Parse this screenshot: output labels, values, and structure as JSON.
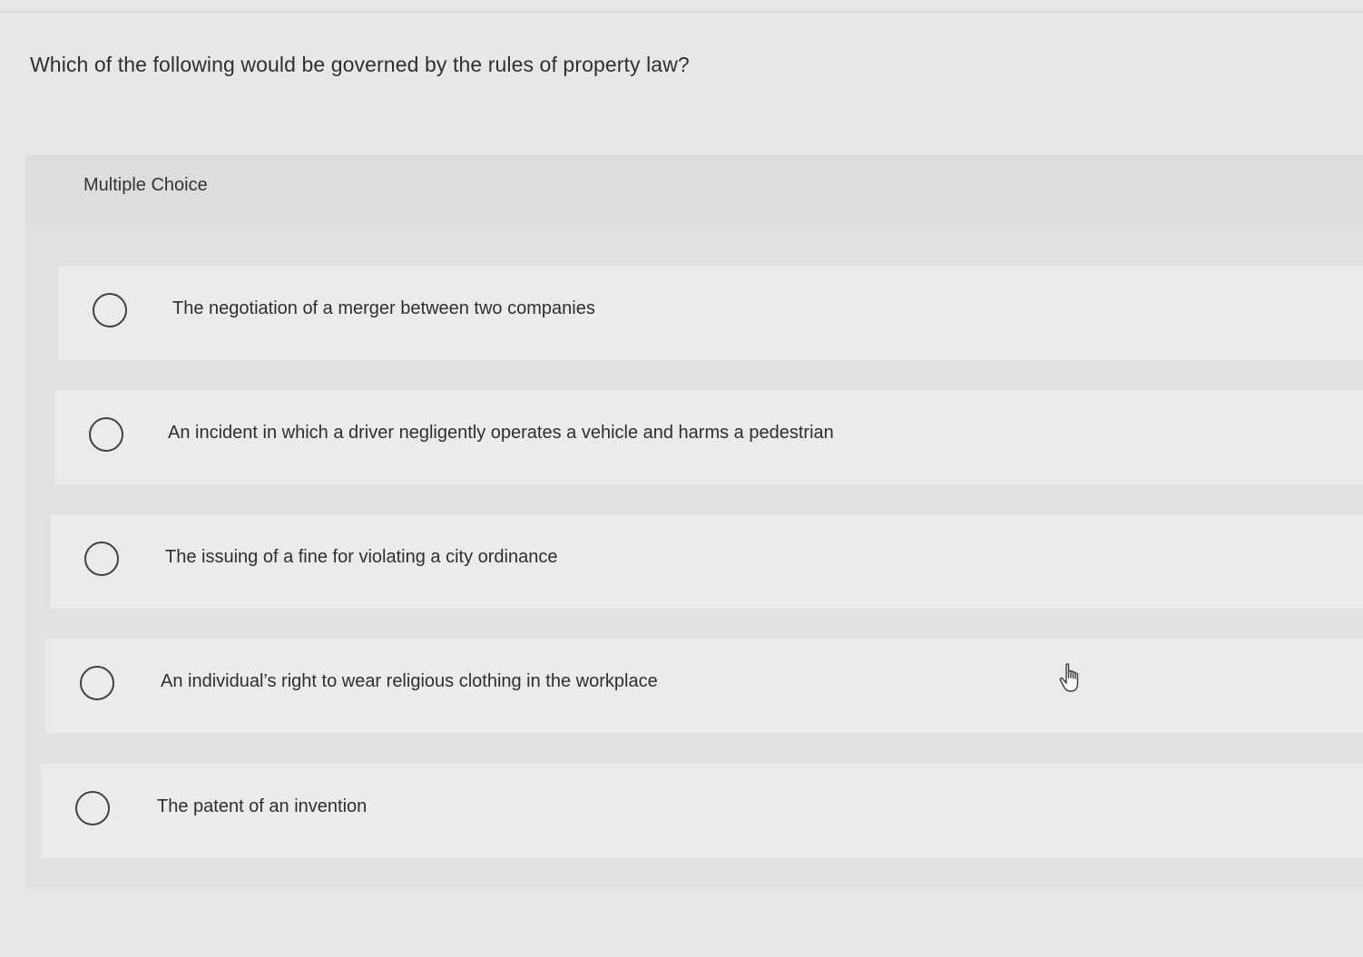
{
  "question": {
    "text": "Which of the following would be governed by the rules of property law?"
  },
  "section": {
    "label": "Multiple Choice"
  },
  "choices": [
    {
      "label": "The negotiation of a merger between two companies",
      "selected": false
    },
    {
      "label": "An incident in which a driver negligently operates a vehicle and harms a pedestrian",
      "selected": false
    },
    {
      "label": "The issuing of a fine for violating a city ordinance",
      "selected": false
    },
    {
      "label": "An individual’s right to wear religious clothing in the workplace",
      "selected": false
    },
    {
      "label": "The patent of an invention",
      "selected": false
    }
  ],
  "icons": {
    "radio": "radio-unselected-icon",
    "cursor": "hand-pointer-icon"
  },
  "colors": {
    "background": "#e7e8e6",
    "header_band": "#dcdddc",
    "choice_card": "#ebecea",
    "text": "#2d2e30"
  }
}
